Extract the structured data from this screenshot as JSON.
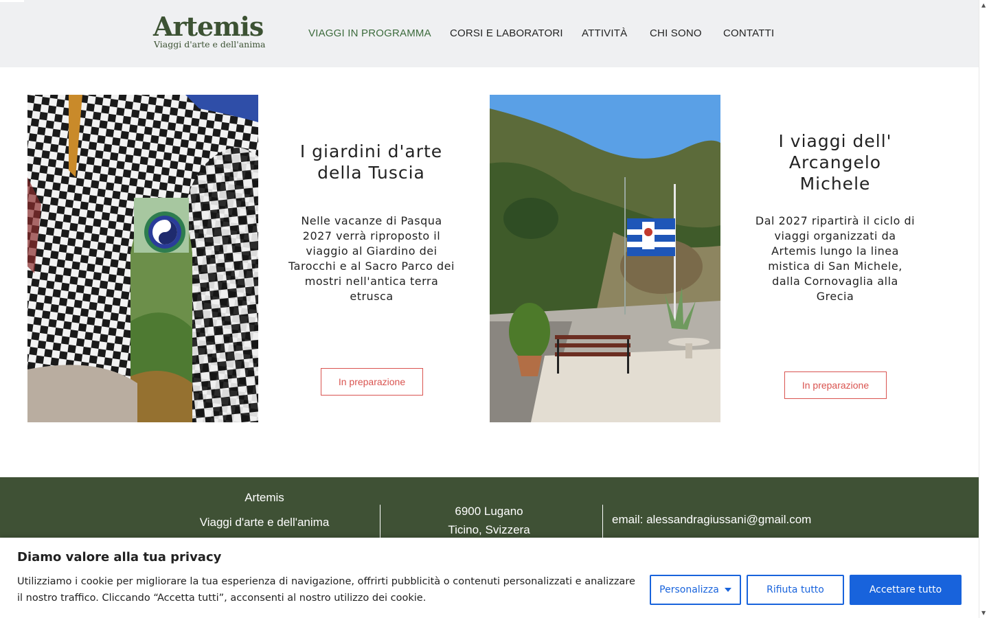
{
  "header": {
    "logo_title": "Artemis",
    "logo_subtitle": "Viaggi d'arte e dell'anima",
    "nav": [
      {
        "label": "VIAGGI IN PROGRAMMA",
        "active": true
      },
      {
        "label": "CORSI E LABORATORI",
        "active": false
      },
      {
        "label": "ATTIVITÀ",
        "active": false
      },
      {
        "label": "CHI SONO",
        "active": false
      },
      {
        "label": "CONTATTI",
        "active": false
      }
    ]
  },
  "cards": [
    {
      "title": "I giardini d'arte della Tuscia",
      "description": "Nelle vacanze di Pasqua 2027 verrà  riproposto il viaggio al Giardino dei Tarocchi e al Sacro Parco dei mostri nell'antica terra etrusca",
      "button": "In preparazione"
    },
    {
      "title": "I viaggi dell' Arcangelo Michele",
      "description": "Dal 2027 ripartirà il ciclo di viaggi organizzati da Artemis lungo la linea mistica di San Michele, dalla Cornovaglia alla Grecia",
      "button": "In preparazione"
    }
  ],
  "footer": {
    "brand": "Artemis",
    "tagline": "Viaggi d'arte e dell'anima",
    "city": "6900 Lugano",
    "region": "Ticino, Svizzera",
    "email": "email: alessandragiussani@gmail.com"
  },
  "cookie": {
    "title": "Diamo valore alla tua privacy",
    "body": "Utilizziamo i cookie per migliorare la tua esperienza di navigazione, offrirti pubblicità o contenuti personalizzati e analizzare il nostro traffico. Cliccando “Accetta tutti”, acconsenti al nostro utilizzo dei cookie.",
    "customize": "Personalizza",
    "reject": "Rifiuta tutto",
    "accept": "Accettare tutto"
  },
  "colors": {
    "brand_green": "#3c5233",
    "footer_bg": "#3f5135",
    "accent_red": "#d9534f",
    "cookie_blue": "#1863dc"
  }
}
